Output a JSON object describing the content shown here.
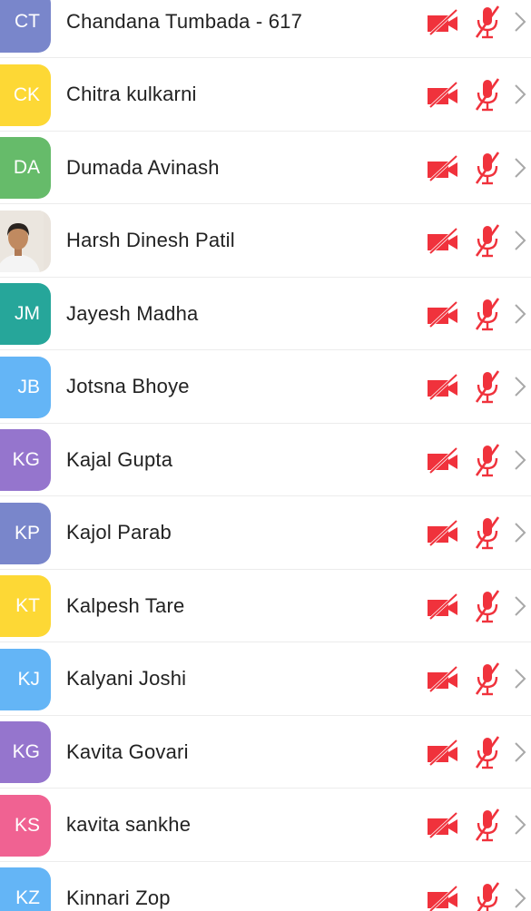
{
  "colors": {
    "muted_icon": "#f0323c",
    "chevron": "#a8a8a8",
    "divider": "#ececec",
    "name_text": "#222222"
  },
  "icons": {
    "video_status": "video-off-icon",
    "audio_status": "mic-off-icon",
    "row_action": "chevron-right-icon"
  },
  "participants": [
    {
      "initials": "CT",
      "name": "Chandana Tumbada - 617",
      "avatar_color": "#7986cb",
      "video": "off",
      "audio": "muted"
    },
    {
      "initials": "CK",
      "name": "Chitra kulkarni",
      "avatar_color": "#fdd835",
      "video": "off",
      "audio": "muted"
    },
    {
      "initials": "DA",
      "name": "Dumada Avinash",
      "avatar_color": "#66bb6a",
      "video": "off",
      "audio": "muted"
    },
    {
      "initials": "",
      "name": "Harsh Dinesh Patil",
      "avatar_color": "#e9e3dc",
      "avatar_type": "photo",
      "video": "off",
      "audio": "muted"
    },
    {
      "initials": "JM",
      "name": "Jayesh Madha",
      "avatar_color": "#26a69a",
      "video": "off",
      "audio": "muted"
    },
    {
      "initials": "JB",
      "name": "Jotsna Bhoye",
      "avatar_color": "#64b5f6",
      "video": "off",
      "audio": "muted"
    },
    {
      "initials": "KG",
      "name": "Kajal Gupta",
      "avatar_color": "#9575cd",
      "video": "off",
      "audio": "muted"
    },
    {
      "initials": "KP",
      "name": "Kajol Parab",
      "avatar_color": "#7986cb",
      "video": "off",
      "audio": "muted"
    },
    {
      "initials": "KT",
      "name": "Kalpesh Tare",
      "avatar_color": "#fdd835",
      "video": "off",
      "audio": "muted"
    },
    {
      "initials": "KJ",
      "name": "Kalyani Joshi",
      "avatar_color": "#64b5f6",
      "video": "off",
      "audio": "muted"
    },
    {
      "initials": "KG",
      "name": "Kavita Govari",
      "avatar_color": "#9575cd",
      "video": "off",
      "audio": "muted"
    },
    {
      "initials": "KS",
      "name": "kavita sankhe",
      "avatar_color": "#f06292",
      "video": "off",
      "audio": "muted"
    },
    {
      "initials": "KZ",
      "name": "Kinnari Zop",
      "avatar_color": "#64b5f6",
      "video": "off",
      "audio": "muted"
    }
  ]
}
